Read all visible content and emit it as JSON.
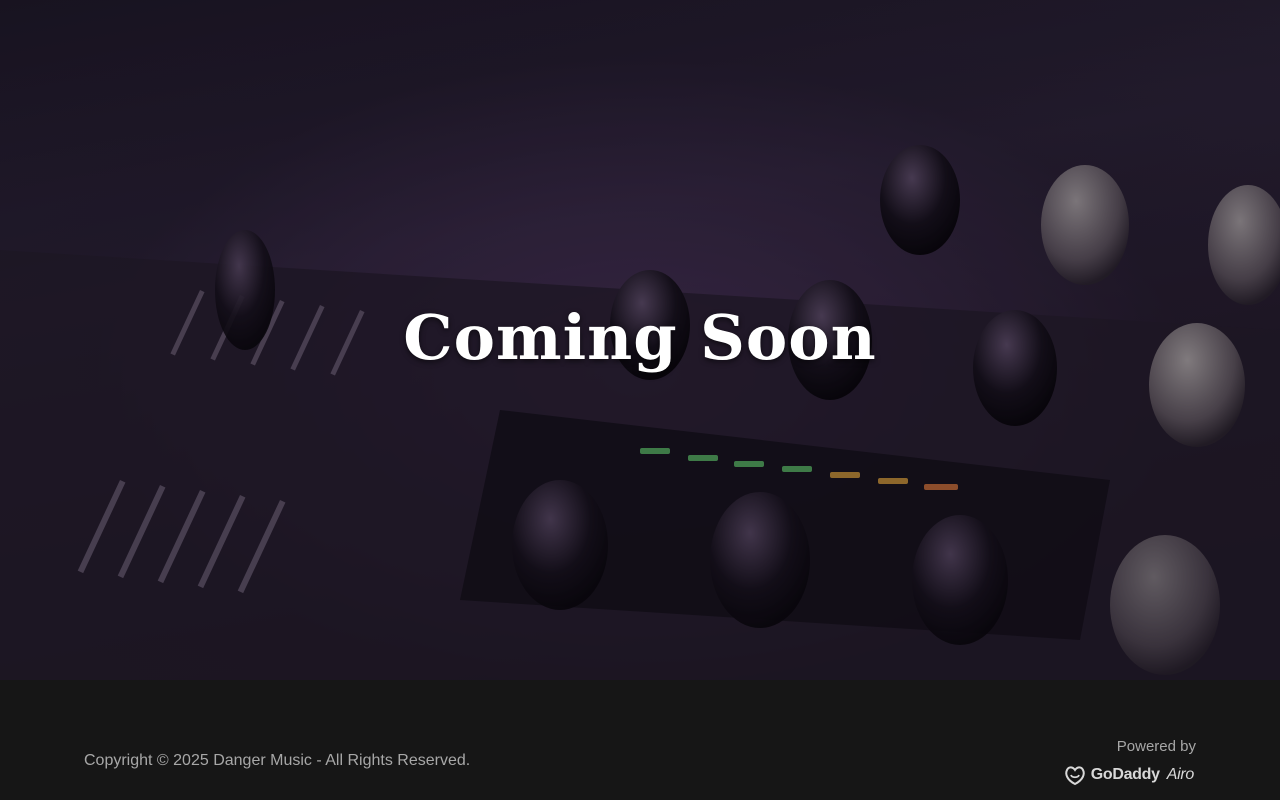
{
  "hero": {
    "title": "Coming Soon",
    "background_image": "dj-mixer-console-photo"
  },
  "footer": {
    "copyright": "Copyright © 2025 Danger Music - All Rights Reserved.",
    "powered_by": "Powered by",
    "brand": {
      "icon": "godaddy-logo-icon",
      "name": "GoDaddy",
      "product": "Airo"
    }
  },
  "colors": {
    "footer_background": "#161616",
    "footer_text": "#a7a7a7",
    "title_text": "#ffffff"
  }
}
